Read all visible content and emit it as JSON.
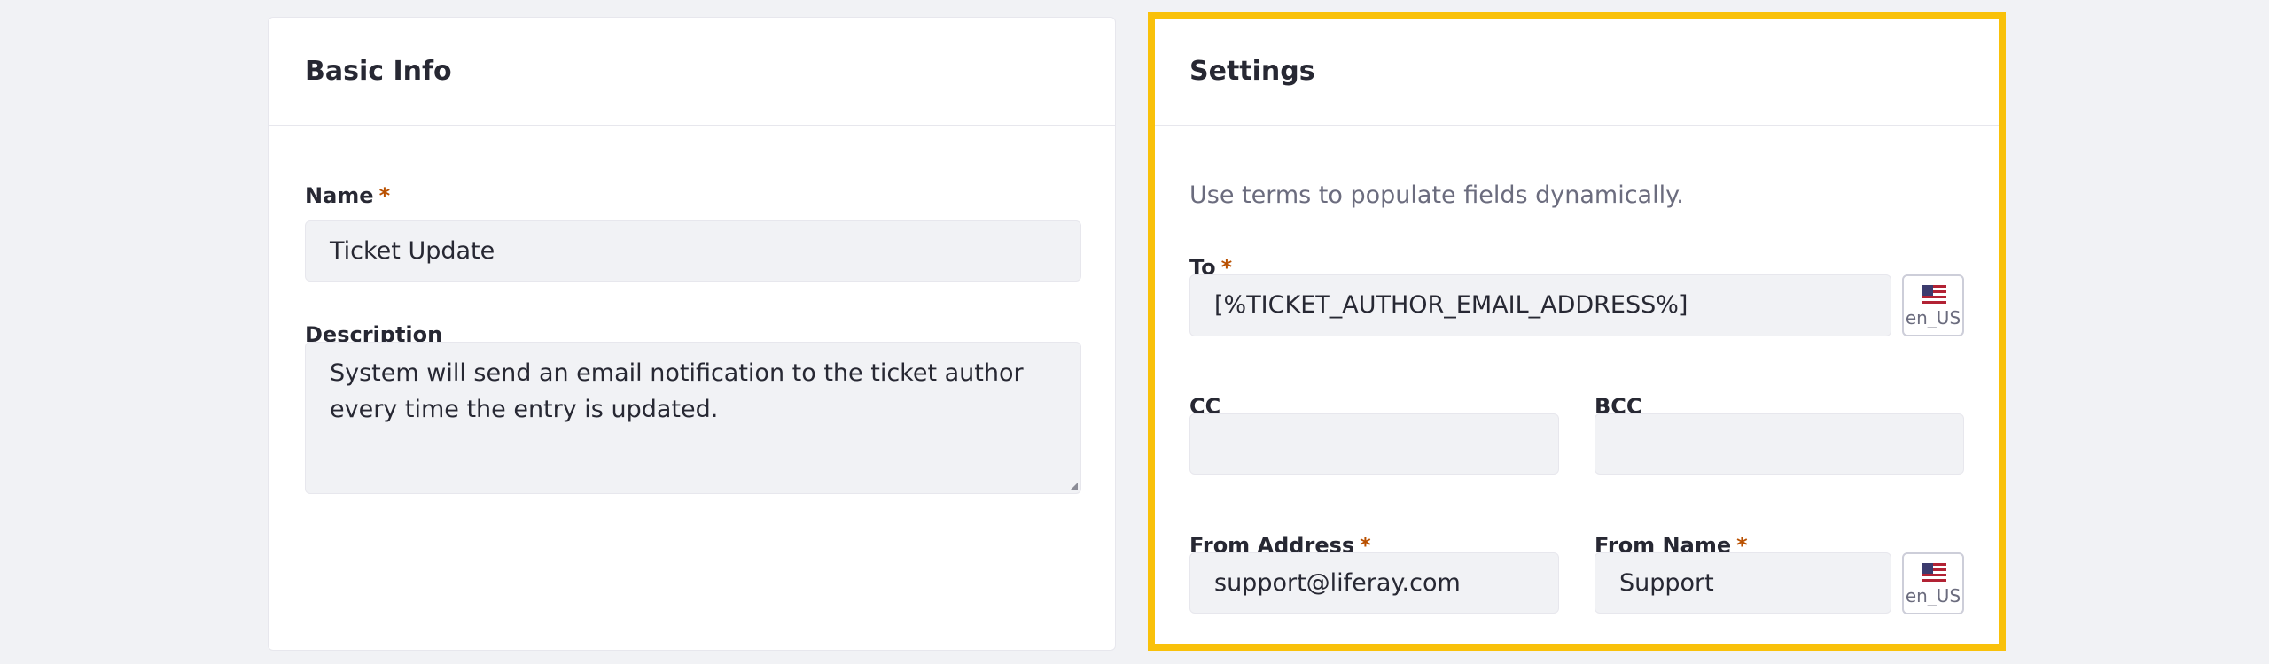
{
  "basic_info": {
    "title": "Basic Info",
    "name_label": "Name",
    "name_required": "*",
    "name_value": "Ticket Update",
    "description_label": "Description",
    "description_value": "System will send an email notification to the ticket author every time the entry is updated."
  },
  "settings": {
    "title": "Settings",
    "help_text": "Use terms to populate fields dynamically.",
    "to_label": "To",
    "to_required": "*",
    "to_value": "[%TICKET_AUTHOR_EMAIL_ADDRESS%]",
    "to_locale": "en_US",
    "cc_label": "CC",
    "cc_value": "",
    "bcc_label": "BCC",
    "bcc_value": "",
    "from_address_label": "From Address",
    "from_address_required": "*",
    "from_address_value": "support@liferay.com",
    "from_name_label": "From Name",
    "from_name_required": "*",
    "from_name_value": "Support",
    "from_name_locale": "en_US"
  },
  "colors": {
    "page_background": "#f1f2f5",
    "card_background": "#ffffff",
    "input_background": "#f1f2f5",
    "required_marker": "#b95000",
    "highlight_frame": "#f9c10a",
    "help_text": "#6b6c7e"
  },
  "icons": {
    "locale_flag": "us-flag-icon"
  }
}
